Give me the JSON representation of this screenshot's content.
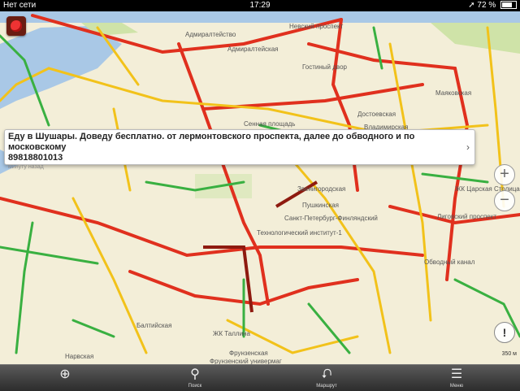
{
  "status_bar": {
    "carrier": "Нет сети",
    "time": "17:29",
    "battery_text": "72 %",
    "battery_level": 0.72
  },
  "map": {
    "street_labels": [
      {
        "text": "Адмиралтейство",
        "id": "admiralteystvo"
      },
      {
        "text": "Адмиралтейская",
        "id": "admiralteyskaya"
      },
      {
        "text": "Невский проспект",
        "id": "nevsky"
      },
      {
        "text": "Гостиный двор",
        "id": "gostiny"
      },
      {
        "text": "Сенная площадь",
        "id": "sennaya"
      },
      {
        "text": "Достоевская",
        "id": "dostoevskaya"
      },
      {
        "text": "Маяковская",
        "id": "mayakovskaya"
      },
      {
        "text": "Владимирская",
        "id": "vladimirskaya"
      },
      {
        "text": "Пушкинская",
        "id": "pushkinskaya"
      },
      {
        "text": "Звенигородская",
        "id": "zvenigorodskaya"
      },
      {
        "text": "Технологический институт-1",
        "id": "tekhnolog"
      },
      {
        "text": "Обводный канал",
        "id": "obvodny"
      },
      {
        "text": "Балтийская",
        "id": "baltiyskaya"
      },
      {
        "text": "Фрунзенская",
        "id": "frunzenskaya"
      },
      {
        "text": "Нарвская",
        "id": "narvskaya"
      },
      {
        "text": "ЖК Царская Столица",
        "id": "tsarskaya"
      },
      {
        "text": "Санкт-Петербург-Финляндский",
        "id": "spb_vitebsky"
      },
      {
        "text": "ЖК Таллина",
        "id": "tallina"
      },
      {
        "text": "Фрунзенский универмаг",
        "id": "univermag"
      },
      {
        "text": "Лиговский проспект",
        "id": "ligovsky"
      }
    ]
  },
  "popup": {
    "line1": "Еду в Шушары. Доведу бесплатно. от лермонтовского проспекта, далее до обводного и по московскому",
    "line2": "89818801013",
    "time": "минуту назад",
    "chevron": "›"
  },
  "controls": {
    "zoom_in": "+",
    "zoom_out": "−",
    "info": "!",
    "scale": "350 м"
  },
  "toolbar": {
    "items": [
      {
        "id": "locate",
        "label": "",
        "icon": "⊕"
      },
      {
        "id": "search",
        "label": "Поиск",
        "icon": "⚲"
      },
      {
        "id": "route",
        "label": "Маршрут",
        "icon": "⮏"
      },
      {
        "id": "menu",
        "label": "Меню",
        "icon": "☰"
      }
    ]
  }
}
